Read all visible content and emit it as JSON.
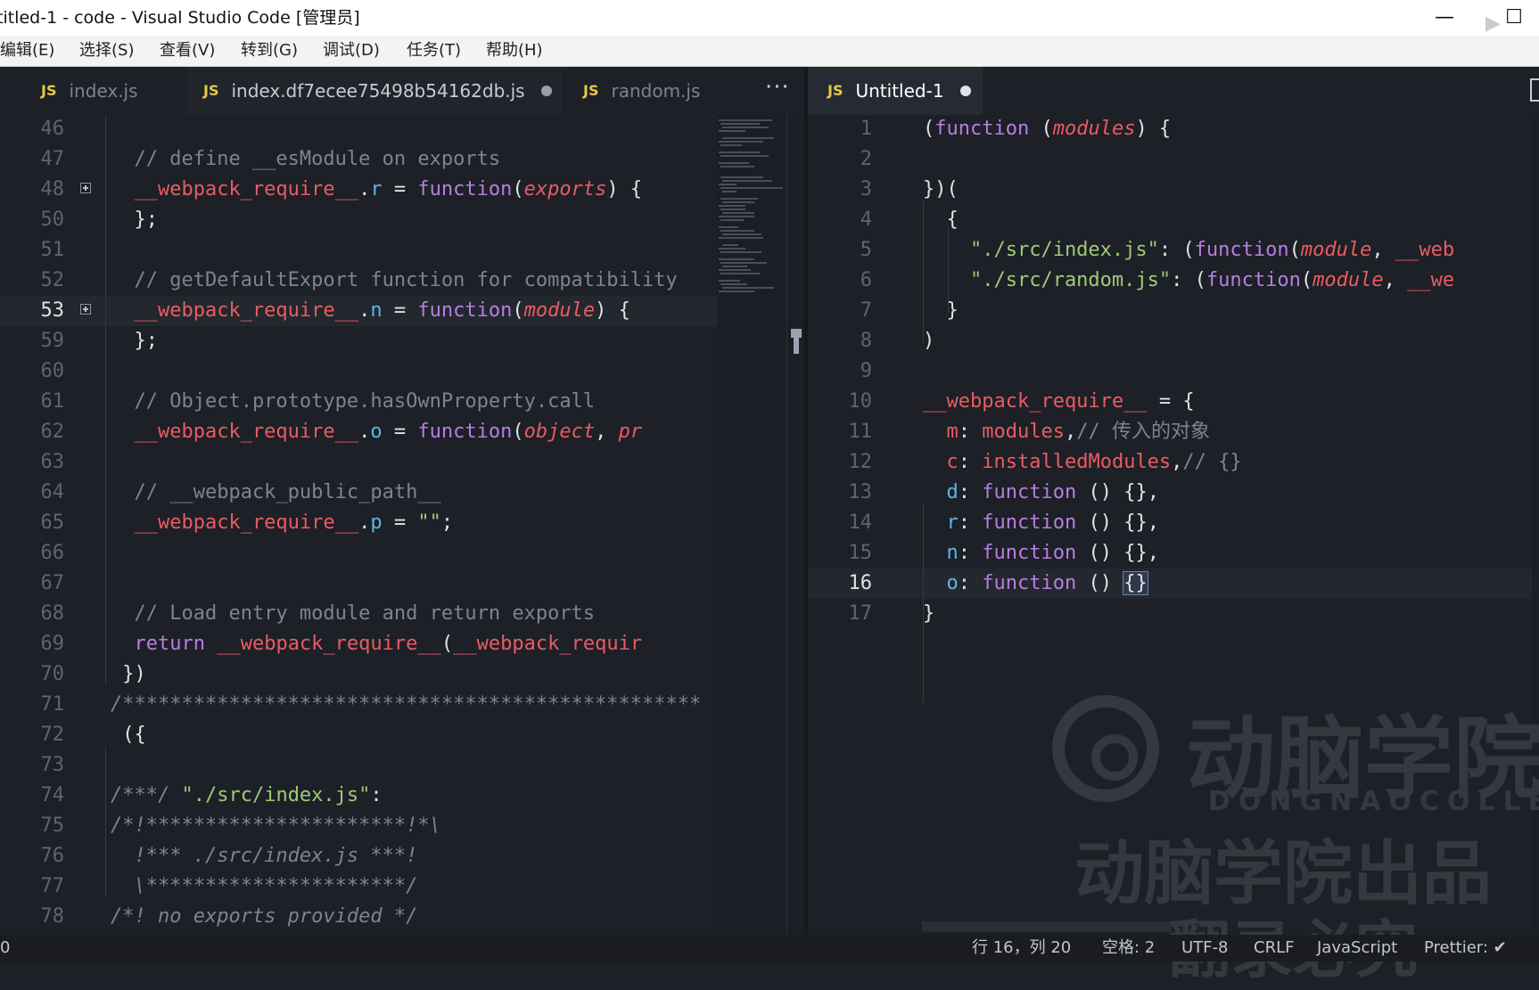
{
  "window": {
    "title": "titled-1 - code - Visual Studio Code [管理员]",
    "minimize": "—",
    "maximize": "☐"
  },
  "menu": [
    "编辑(E)",
    "选择(S)",
    "查看(V)",
    "转到(G)",
    "调试(D)",
    "任务(T)",
    "帮助(H)"
  ],
  "tabs_left": [
    {
      "icon": "JS",
      "label": "index.js"
    },
    {
      "icon": "JS",
      "label": "index.df7ecee75498b54162db.js"
    },
    {
      "icon": "JS",
      "label": "random.js"
    }
  ],
  "tabs_more": "···",
  "tabs_right": [
    {
      "icon": "JS",
      "label": "Untitled-1"
    }
  ],
  "run_glyph": "▶",
  "left_editor": {
    "lines": [
      {
        "n": "46",
        "tokens": []
      },
      {
        "n": "47",
        "tokens": [
          [
            "c-cm",
            "  // define __esModule on exports"
          ]
        ]
      },
      {
        "n": "48",
        "fold": true,
        "tokens": [
          [
            "c-red",
            "  __webpack_require__"
          ],
          [
            "c-plain",
            "."
          ],
          [
            "c-cyan",
            "r"
          ],
          [
            "c-plain",
            " = "
          ],
          [
            "c-pur",
            "function"
          ],
          [
            "c-plain",
            "("
          ],
          [
            "c-par",
            "exports"
          ],
          [
            "c-plain",
            ") {"
          ]
        ]
      },
      {
        "n": "50",
        "tokens": [
          [
            "c-plain",
            "  };"
          ]
        ]
      },
      {
        "n": "51",
        "tokens": []
      },
      {
        "n": "52",
        "tokens": [
          [
            "c-cm",
            "  // getDefaultExport function for compatibility"
          ]
        ]
      },
      {
        "n": "53",
        "fold": true,
        "current": true,
        "tokens": [
          [
            "c-red",
            "  __webpack_require__"
          ],
          [
            "c-plain",
            "."
          ],
          [
            "c-cyan",
            "n"
          ],
          [
            "c-plain",
            " = "
          ],
          [
            "c-pur",
            "function"
          ],
          [
            "c-plain",
            "("
          ],
          [
            "c-par",
            "module"
          ],
          [
            "c-plain",
            ") {"
          ]
        ]
      },
      {
        "n": "59",
        "tokens": [
          [
            "c-plain",
            "  };"
          ]
        ]
      },
      {
        "n": "60",
        "tokens": []
      },
      {
        "n": "61",
        "tokens": [
          [
            "c-cm",
            "  // Object.prototype.hasOwnProperty.call"
          ]
        ]
      },
      {
        "n": "62",
        "tokens": [
          [
            "c-red",
            "  __webpack_require__"
          ],
          [
            "c-plain",
            "."
          ],
          [
            "c-cyan",
            "o"
          ],
          [
            "c-plain",
            " = "
          ],
          [
            "c-pur",
            "function"
          ],
          [
            "c-plain",
            "("
          ],
          [
            "c-par",
            "object"
          ],
          [
            "c-plain",
            ", "
          ],
          [
            "c-par",
            "pr"
          ]
        ]
      },
      {
        "n": "63",
        "tokens": []
      },
      {
        "n": "64",
        "tokens": [
          [
            "c-cm",
            "  // __webpack_public_path__"
          ]
        ]
      },
      {
        "n": "65",
        "tokens": [
          [
            "c-red",
            "  __webpack_require__"
          ],
          [
            "c-plain",
            "."
          ],
          [
            "c-cyan",
            "p"
          ],
          [
            "c-plain",
            " = "
          ],
          [
            "c-str",
            "\"\""
          ],
          [
            "c-plain",
            ";"
          ]
        ]
      },
      {
        "n": "66",
        "tokens": []
      },
      {
        "n": "67",
        "tokens": []
      },
      {
        "n": "68",
        "tokens": [
          [
            "c-cm",
            "  // Load entry module and return exports"
          ]
        ]
      },
      {
        "n": "69",
        "tokens": [
          [
            "c-pur",
            "  return "
          ],
          [
            "c-red",
            "__webpack_require__"
          ],
          [
            "c-plain",
            "("
          ],
          [
            "c-red",
            "__webpack_requir"
          ]
        ]
      },
      {
        "n": "70",
        "tokens": [
          [
            "c-plain",
            " })"
          ]
        ]
      },
      {
        "n": "71",
        "tokens": [
          [
            "c-cmi",
            "/*************************************************"
          ]
        ]
      },
      {
        "n": "72",
        "tokens": [
          [
            "c-plain",
            " ({"
          ]
        ]
      },
      {
        "n": "73",
        "tokens": []
      },
      {
        "n": "74",
        "tokens": [
          [
            "c-cmi",
            "/***/ "
          ],
          [
            "c-str",
            "\"./src/index.js\""
          ],
          [
            "c-plain",
            ":"
          ]
        ]
      },
      {
        "n": "75",
        "tokens": [
          [
            "c-cmi",
            "/*!**********************!*\\"
          ]
        ]
      },
      {
        "n": "76",
        "tokens": [
          [
            "c-cmi",
            "  !*** ./src/index.js ***!"
          ]
        ]
      },
      {
        "n": "77",
        "tokens": [
          [
            "c-cmi",
            "  \\**********************/"
          ]
        ]
      },
      {
        "n": "78",
        "tokens": [
          [
            "c-cmi",
            "/*! no exports provided */"
          ]
        ]
      }
    ]
  },
  "right_editor": {
    "lines": [
      {
        "n": "1",
        "tokens": [
          [
            "c-plain",
            "("
          ],
          [
            "c-pur",
            "function"
          ],
          [
            "c-plain",
            " ("
          ],
          [
            "c-par",
            "modules"
          ],
          [
            "c-plain",
            ") {"
          ]
        ]
      },
      {
        "n": "2",
        "tokens": []
      },
      {
        "n": "3",
        "tokens": [
          [
            "c-plain",
            "})("
          ]
        ]
      },
      {
        "n": "4",
        "tokens": [
          [
            "c-plain",
            "  {"
          ]
        ]
      },
      {
        "n": "5",
        "tokens": [
          [
            "c-str",
            "    \"./src/index.js\""
          ],
          [
            "c-plain",
            ": ("
          ],
          [
            "c-pur",
            "function"
          ],
          [
            "c-plain",
            "("
          ],
          [
            "c-par",
            "module"
          ],
          [
            "c-plain",
            ", "
          ],
          [
            "c-red",
            "__web"
          ]
        ]
      },
      {
        "n": "6",
        "tokens": [
          [
            "c-str",
            "    \"./src/random.js\""
          ],
          [
            "c-plain",
            ": ("
          ],
          [
            "c-pur",
            "function"
          ],
          [
            "c-plain",
            "("
          ],
          [
            "c-par",
            "module"
          ],
          [
            "c-plain",
            ", "
          ],
          [
            "c-red",
            "__we"
          ]
        ]
      },
      {
        "n": "7",
        "tokens": [
          [
            "c-plain",
            "  }"
          ]
        ]
      },
      {
        "n": "8",
        "tokens": [
          [
            "c-plain",
            ")"
          ]
        ]
      },
      {
        "n": "9",
        "tokens": []
      },
      {
        "n": "10",
        "tokens": [
          [
            "c-red",
            "__webpack_require__"
          ],
          [
            "c-plain",
            " = {"
          ]
        ]
      },
      {
        "n": "11",
        "tokens": [
          [
            "c-red",
            "  m"
          ],
          [
            "c-plain",
            ": "
          ],
          [
            "c-red",
            "modules"
          ],
          [
            "c-plain",
            ","
          ],
          [
            "c-cm",
            "// 传入的对象"
          ]
        ]
      },
      {
        "n": "12",
        "tokens": [
          [
            "c-red",
            "  c"
          ],
          [
            "c-plain",
            ": "
          ],
          [
            "c-red",
            "installedModules"
          ],
          [
            "c-plain",
            ","
          ],
          [
            "c-cm",
            "// {}"
          ]
        ]
      },
      {
        "n": "13",
        "tokens": [
          [
            "c-cyan",
            "  d"
          ],
          [
            "c-plain",
            ": "
          ],
          [
            "c-pur",
            "function"
          ],
          [
            "c-plain",
            " () {},"
          ]
        ]
      },
      {
        "n": "14",
        "tokens": [
          [
            "c-cyan",
            "  r"
          ],
          [
            "c-plain",
            ": "
          ],
          [
            "c-pur",
            "function"
          ],
          [
            "c-plain",
            " () {},"
          ]
        ]
      },
      {
        "n": "15",
        "tokens": [
          [
            "c-cyan",
            "  n"
          ],
          [
            "c-plain",
            ": "
          ],
          [
            "c-pur",
            "function"
          ],
          [
            "c-plain",
            " () {},"
          ]
        ]
      },
      {
        "n": "16",
        "current": true,
        "tokens": [
          [
            "c-cyan",
            "  o"
          ],
          [
            "c-plain",
            ": "
          ],
          [
            "c-pur",
            "function"
          ],
          [
            "c-plain",
            " () "
          ],
          [
            "bracket-hl",
            "{}"
          ]
        ]
      },
      {
        "n": "17",
        "tokens": [
          [
            "c-plain",
            "}"
          ]
        ]
      }
    ]
  },
  "watermark": {
    "big": "动脑学院",
    "en": "DONGNAOCOLLEGE",
    "mid": "动脑学院出品",
    "low": "翻录必究"
  },
  "status": {
    "left": "0",
    "position": "行 16，列 20",
    "spaces": "空格: 2",
    "encoding": "UTF-8",
    "eol": "CRLF",
    "language": "JavaScript",
    "prettier": "Prettier: ✔"
  }
}
